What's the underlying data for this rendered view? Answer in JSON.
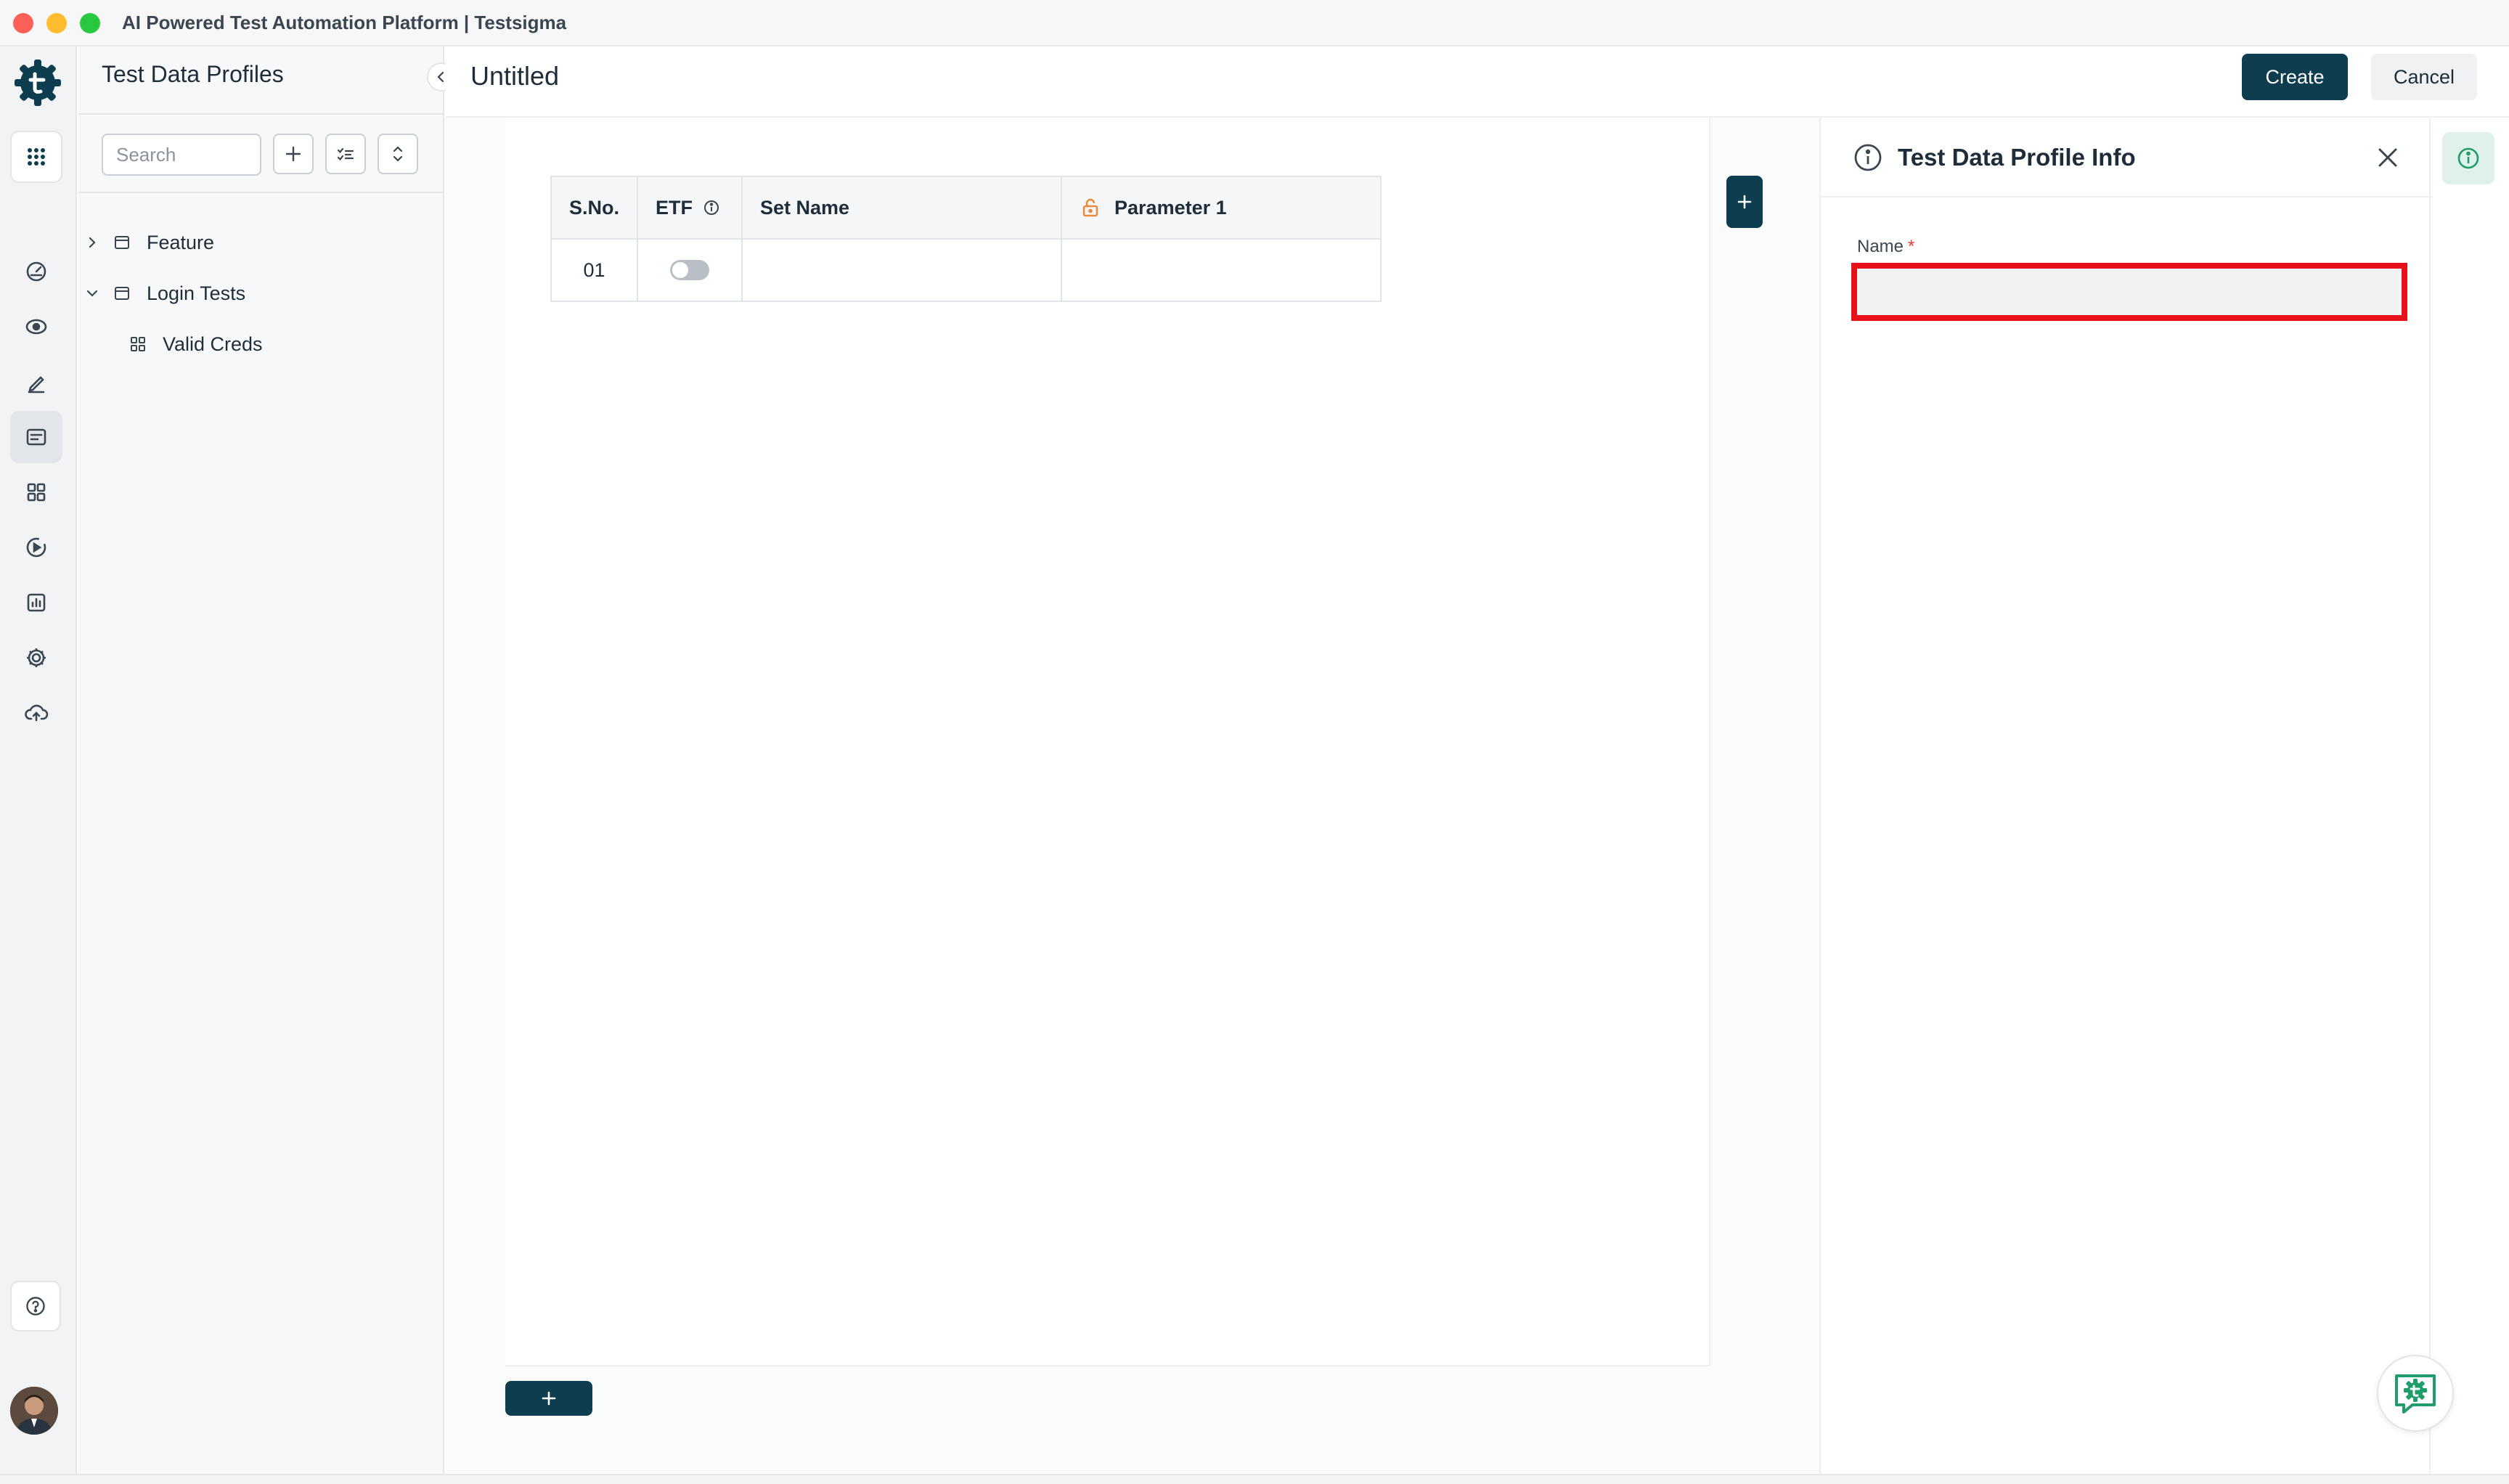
{
  "window": {
    "title": "AI Powered Test Automation Platform | Testsigma"
  },
  "rail": {
    "items": [
      {
        "icon": "apps-grid-icon"
      },
      {
        "icon": "dashboard-gauge-icon"
      },
      {
        "icon": "eye-icon"
      },
      {
        "icon": "pencil-icon"
      },
      {
        "icon": "test-data-icon",
        "active": true
      },
      {
        "icon": "modules-icon"
      },
      {
        "icon": "run-icon"
      },
      {
        "icon": "reports-icon"
      },
      {
        "icon": "gear-icon"
      },
      {
        "icon": "cloud-upload-icon"
      }
    ],
    "help_icon": "help-icon",
    "avatar": "user-avatar"
  },
  "sidebar": {
    "title": "Test Data Profiles",
    "search_placeholder": "Search",
    "tree": [
      {
        "label": "Feature",
        "expanded": false
      },
      {
        "label": "Login Tests",
        "expanded": true
      },
      {
        "label": "Valid Creds",
        "child": true
      }
    ]
  },
  "header": {
    "title": "Untitled",
    "create_label": "Create",
    "cancel_label": "Cancel"
  },
  "grid": {
    "columns": [
      "S.No.",
      "ETF",
      "Set Name",
      "Parameter 1"
    ],
    "rows": [
      {
        "sno": "01",
        "etf": false,
        "set_name": "",
        "param1": ""
      }
    ]
  },
  "panel": {
    "title": "Test Data Profile Info",
    "name_label": "Name",
    "required_mark": "*",
    "name_value": ""
  },
  "colors": {
    "primary": "#0e3d4f",
    "highlight": "#e8101a",
    "lock": "#e8893a",
    "accent_green": "#1f9d6b"
  }
}
